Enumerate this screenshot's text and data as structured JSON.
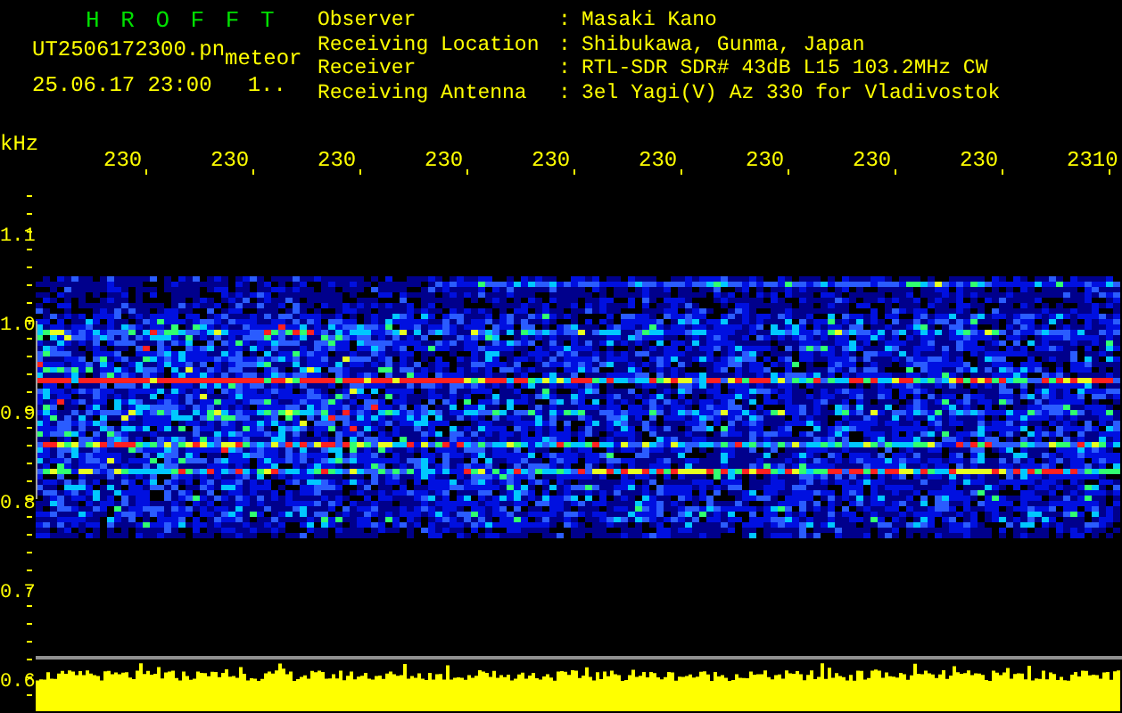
{
  "header": {
    "title": "H R O F F T",
    "file_name": "UT2506172300.pn",
    "mode": "meteor",
    "timestamp": "25.06.17 23:00",
    "counter": "1.."
  },
  "station_info": [
    {
      "label": "Observer",
      "separator": ":",
      "value": "Masaki Kano"
    },
    {
      "label": "Receiving Location",
      "separator": ":",
      "value": "Shibukawa, Gunma, Japan"
    },
    {
      "label": "Receiver",
      "separator": ":",
      "value": "RTL-SDR SDR# 43dB L15 103.2MHz CW"
    },
    {
      "label": "Receiving Antenna",
      "separator": ":",
      "value": "3el Yagi(V) Az 330 for Vladivostok"
    }
  ],
  "spectrogram": {
    "y_unit": "kHz",
    "x_tick_labels": [
      "230",
      "230",
      "230",
      "230",
      "230",
      "230",
      "230",
      "230",
      "230",
      "2310"
    ],
    "y_tick_labels": [
      "1.1",
      "1.0",
      "0.9",
      "0.8",
      "0.7",
      "0.6"
    ]
  }
}
